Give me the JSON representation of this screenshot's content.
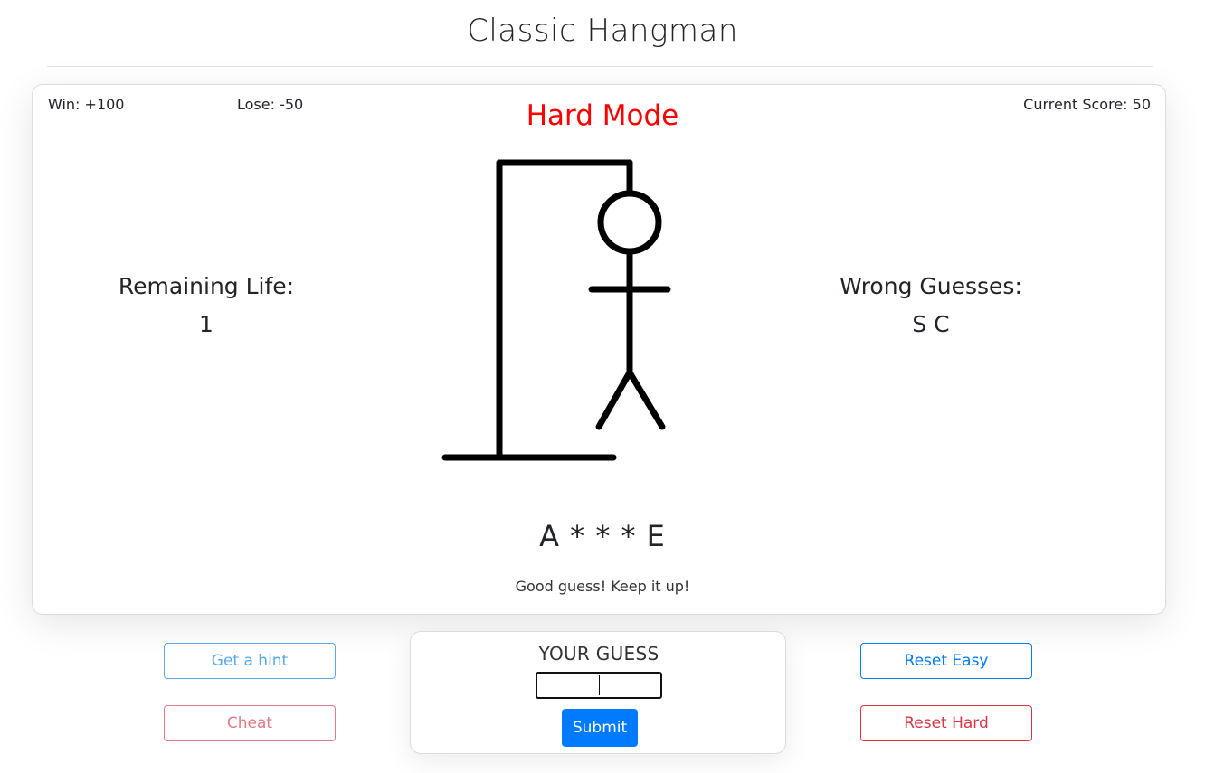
{
  "header": {
    "title": "Classic Hangman"
  },
  "scoreboard": {
    "win": "Win: +100",
    "lose": "Lose: -50",
    "current_score": "Current Score: 50"
  },
  "mode": {
    "label": "Hard Mode",
    "color": "#ff0000"
  },
  "life": {
    "label": "Remaining Life:",
    "value": "1"
  },
  "wrong_guesses": {
    "label": "Wrong Guesses:",
    "value": "S C"
  },
  "puzzle": {
    "word_display": "A * * * E",
    "message": "Good guess! Keep it up!"
  },
  "hangman": {
    "parts_drawn": [
      "head",
      "body",
      "arms",
      "legs"
    ]
  },
  "controls": {
    "hint_label": "Get a hint",
    "cheat_label": "Cheat",
    "reset_easy_label": "Reset Easy",
    "reset_hard_label": "Reset Hard"
  },
  "guess_panel": {
    "label": "YOUR GUESS",
    "input_value": "",
    "submit_label": "Submit"
  },
  "colors": {
    "primary": "#007bff",
    "danger": "#dc3545",
    "hint": "#5aa7f2",
    "cheat": "#e07a85"
  }
}
